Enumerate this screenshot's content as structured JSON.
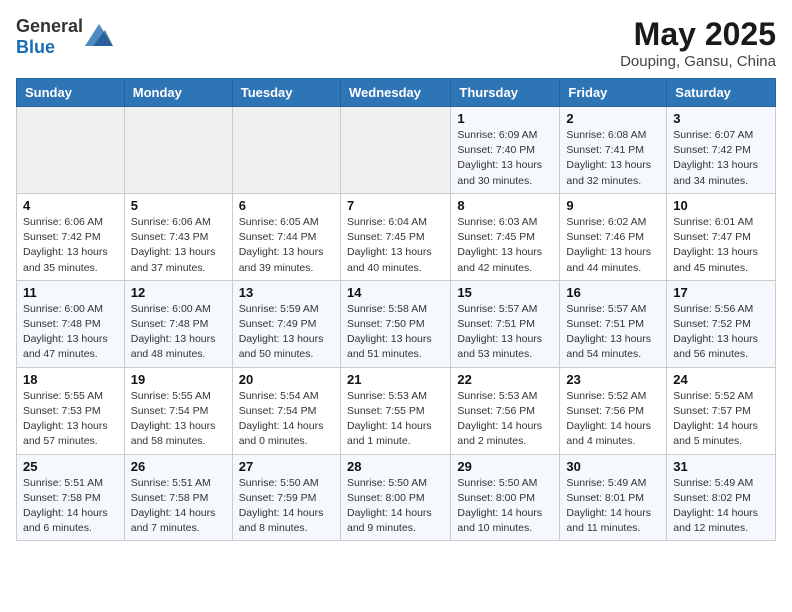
{
  "header": {
    "logo_general": "General",
    "logo_blue": "Blue",
    "month": "May 2025",
    "location": "Douping, Gansu, China"
  },
  "weekdays": [
    "Sunday",
    "Monday",
    "Tuesday",
    "Wednesday",
    "Thursday",
    "Friday",
    "Saturday"
  ],
  "weeks": [
    [
      {
        "day": "",
        "detail": ""
      },
      {
        "day": "",
        "detail": ""
      },
      {
        "day": "",
        "detail": ""
      },
      {
        "day": "",
        "detail": ""
      },
      {
        "day": "1",
        "detail": "Sunrise: 6:09 AM\nSunset: 7:40 PM\nDaylight: 13 hours\nand 30 minutes."
      },
      {
        "day": "2",
        "detail": "Sunrise: 6:08 AM\nSunset: 7:41 PM\nDaylight: 13 hours\nand 32 minutes."
      },
      {
        "day": "3",
        "detail": "Sunrise: 6:07 AM\nSunset: 7:42 PM\nDaylight: 13 hours\nand 34 minutes."
      }
    ],
    [
      {
        "day": "4",
        "detail": "Sunrise: 6:06 AM\nSunset: 7:42 PM\nDaylight: 13 hours\nand 35 minutes."
      },
      {
        "day": "5",
        "detail": "Sunrise: 6:06 AM\nSunset: 7:43 PM\nDaylight: 13 hours\nand 37 minutes."
      },
      {
        "day": "6",
        "detail": "Sunrise: 6:05 AM\nSunset: 7:44 PM\nDaylight: 13 hours\nand 39 minutes."
      },
      {
        "day": "7",
        "detail": "Sunrise: 6:04 AM\nSunset: 7:45 PM\nDaylight: 13 hours\nand 40 minutes."
      },
      {
        "day": "8",
        "detail": "Sunrise: 6:03 AM\nSunset: 7:45 PM\nDaylight: 13 hours\nand 42 minutes."
      },
      {
        "day": "9",
        "detail": "Sunrise: 6:02 AM\nSunset: 7:46 PM\nDaylight: 13 hours\nand 44 minutes."
      },
      {
        "day": "10",
        "detail": "Sunrise: 6:01 AM\nSunset: 7:47 PM\nDaylight: 13 hours\nand 45 minutes."
      }
    ],
    [
      {
        "day": "11",
        "detail": "Sunrise: 6:00 AM\nSunset: 7:48 PM\nDaylight: 13 hours\nand 47 minutes."
      },
      {
        "day": "12",
        "detail": "Sunrise: 6:00 AM\nSunset: 7:48 PM\nDaylight: 13 hours\nand 48 minutes."
      },
      {
        "day": "13",
        "detail": "Sunrise: 5:59 AM\nSunset: 7:49 PM\nDaylight: 13 hours\nand 50 minutes."
      },
      {
        "day": "14",
        "detail": "Sunrise: 5:58 AM\nSunset: 7:50 PM\nDaylight: 13 hours\nand 51 minutes."
      },
      {
        "day": "15",
        "detail": "Sunrise: 5:57 AM\nSunset: 7:51 PM\nDaylight: 13 hours\nand 53 minutes."
      },
      {
        "day": "16",
        "detail": "Sunrise: 5:57 AM\nSunset: 7:51 PM\nDaylight: 13 hours\nand 54 minutes."
      },
      {
        "day": "17",
        "detail": "Sunrise: 5:56 AM\nSunset: 7:52 PM\nDaylight: 13 hours\nand 56 minutes."
      }
    ],
    [
      {
        "day": "18",
        "detail": "Sunrise: 5:55 AM\nSunset: 7:53 PM\nDaylight: 13 hours\nand 57 minutes."
      },
      {
        "day": "19",
        "detail": "Sunrise: 5:55 AM\nSunset: 7:54 PM\nDaylight: 13 hours\nand 58 minutes."
      },
      {
        "day": "20",
        "detail": "Sunrise: 5:54 AM\nSunset: 7:54 PM\nDaylight: 14 hours\nand 0 minutes."
      },
      {
        "day": "21",
        "detail": "Sunrise: 5:53 AM\nSunset: 7:55 PM\nDaylight: 14 hours\nand 1 minute."
      },
      {
        "day": "22",
        "detail": "Sunrise: 5:53 AM\nSunset: 7:56 PM\nDaylight: 14 hours\nand 2 minutes."
      },
      {
        "day": "23",
        "detail": "Sunrise: 5:52 AM\nSunset: 7:56 PM\nDaylight: 14 hours\nand 4 minutes."
      },
      {
        "day": "24",
        "detail": "Sunrise: 5:52 AM\nSunset: 7:57 PM\nDaylight: 14 hours\nand 5 minutes."
      }
    ],
    [
      {
        "day": "25",
        "detail": "Sunrise: 5:51 AM\nSunset: 7:58 PM\nDaylight: 14 hours\nand 6 minutes."
      },
      {
        "day": "26",
        "detail": "Sunrise: 5:51 AM\nSunset: 7:58 PM\nDaylight: 14 hours\nand 7 minutes."
      },
      {
        "day": "27",
        "detail": "Sunrise: 5:50 AM\nSunset: 7:59 PM\nDaylight: 14 hours\nand 8 minutes."
      },
      {
        "day": "28",
        "detail": "Sunrise: 5:50 AM\nSunset: 8:00 PM\nDaylight: 14 hours\nand 9 minutes."
      },
      {
        "day": "29",
        "detail": "Sunrise: 5:50 AM\nSunset: 8:00 PM\nDaylight: 14 hours\nand 10 minutes."
      },
      {
        "day": "30",
        "detail": "Sunrise: 5:49 AM\nSunset: 8:01 PM\nDaylight: 14 hours\nand 11 minutes."
      },
      {
        "day": "31",
        "detail": "Sunrise: 5:49 AM\nSunset: 8:02 PM\nDaylight: 14 hours\nand 12 minutes."
      }
    ]
  ]
}
